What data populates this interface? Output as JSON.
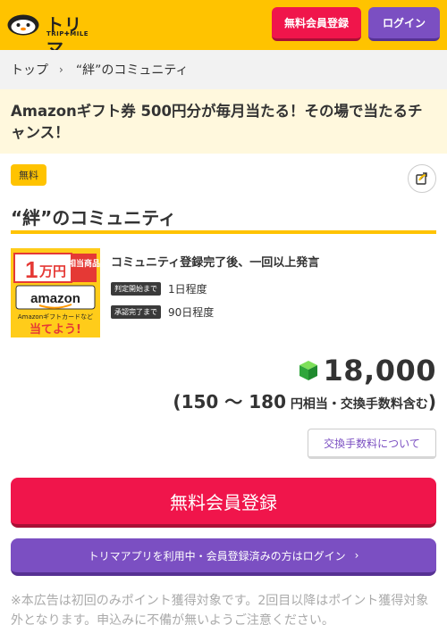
{
  "header": {
    "logo_main": "トリマ",
    "logo_sub": "TRIP✚MILE",
    "register_label": "無料会員登録",
    "login_label": "ログイン"
  },
  "breadcrumb": {
    "home": "トップ",
    "separator": "›",
    "current": "“絆”のコミュニティ"
  },
  "banner": {
    "text": "Amazonギフト券 500円分が毎月当たる！その場で当たるチャンス！"
  },
  "offer": {
    "badge": "無料",
    "title": "“絆”のコミュニティ",
    "thumb": {
      "amount_num": "1",
      "amount_unit": "万円",
      "amount_label": "相当商品",
      "brand": "amazon",
      "caption": "Amazonギフトカードなど",
      "cta": "当てよう!"
    },
    "condition": "コミュニティ登録完了後、一回以上発言",
    "judge_start_tag": "判定開始まで",
    "judge_start_value": "1日程度",
    "approve_tag": "承認完了まで",
    "approve_value": "90日程度",
    "points": "18,000",
    "yen_range": "(150 〜 180",
    "yen_unit": " 円相当・交換手数料含む",
    "yen_close": ")",
    "fee_button": "交換手数料について"
  },
  "actions": {
    "register_big": "無料会員登録",
    "login_big": "トリマアプリを利用中・会員登録済みの方はログイン",
    "chevron": "›"
  },
  "note": "※本広告は初回のみポイント獲得対象です。2回目以降はポイント獲得対象外となります。申込みに不備が無いようご注意ください。",
  "colors": {
    "brand_yellow": "#ffc300",
    "register_red": "#f0154b",
    "login_purple": "#7b4fc2",
    "banner_bg": "#fff8dd"
  }
}
